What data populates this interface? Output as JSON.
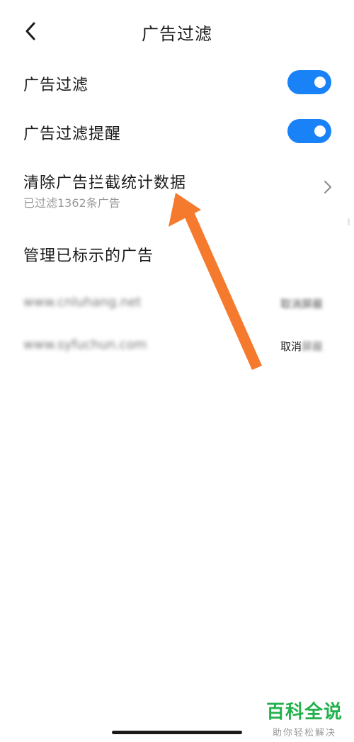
{
  "header": {
    "title": "广告过滤",
    "back_icon": "chevron-left-icon"
  },
  "settings": {
    "ad_filter": {
      "label": "广告过滤",
      "enabled": true
    },
    "ad_filter_reminder": {
      "label": "广告过滤提醒",
      "enabled": true
    },
    "clear_stats": {
      "label": "清除广告拦截统计数据",
      "sublabel": "已过滤1362条广告"
    }
  },
  "manage": {
    "title": "管理已标示的广告",
    "items": [
      {
        "site": "www.cnluhang.net",
        "action": "取消屏蔽"
      },
      {
        "site": "www.syfuchun.com",
        "action_visible": "取消",
        "action_blurred": "屏蔽"
      }
    ]
  },
  "colors": {
    "toggle_on": "#1a82f7",
    "annotation_arrow": "#f57a2e",
    "watermark": "#22b14c"
  },
  "watermark": {
    "main": "百科全说",
    "sub": "助你轻松解决"
  }
}
